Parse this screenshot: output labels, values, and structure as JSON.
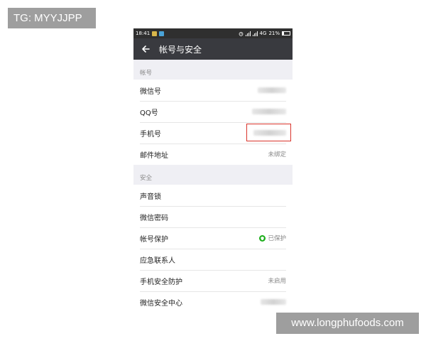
{
  "watermarks": {
    "top": "TG: MYYJJPP",
    "bottom": "www.longphufoods.com"
  },
  "status_bar": {
    "time": "18:41",
    "network": "4G",
    "battery": "21%"
  },
  "header": {
    "title": "帐号与安全"
  },
  "sections": {
    "account": {
      "title": "帐号",
      "rows": [
        {
          "label": "微信号",
          "value": ""
        },
        {
          "label": "QQ号",
          "value": ""
        },
        {
          "label": "手机号",
          "value": ""
        },
        {
          "label": "邮件地址",
          "value": "未绑定"
        }
      ]
    },
    "security": {
      "title": "安全",
      "rows": [
        {
          "label": "声音锁",
          "value": ""
        },
        {
          "label": "微信密码",
          "value": ""
        },
        {
          "label": "帐号保护",
          "value": "已保护"
        },
        {
          "label": "应急联系人",
          "value": ""
        },
        {
          "label": "手机安全防护",
          "value": "未启用"
        },
        {
          "label": "微信安全中心",
          "value": ""
        }
      ]
    }
  },
  "colors": {
    "accent_green": "#1aad19",
    "highlight_red": "#d9342b",
    "title_bar": "#393a3f"
  }
}
